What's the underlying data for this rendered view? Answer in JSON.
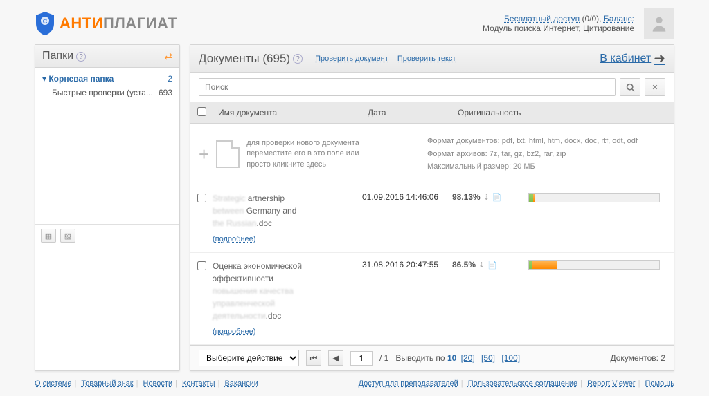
{
  "brand": {
    "part1": "АНТИ",
    "part2": "ПЛАГИАТ"
  },
  "account": {
    "free": "Бесплатный доступ",
    "ratio": "(0/0),",
    "balance": "Баланс:",
    "modules": "Модуль поиска Интернет, Цитирование"
  },
  "sidebar": {
    "title": "Папки",
    "root": {
      "label": "Корневая папка",
      "count": "2"
    },
    "child": {
      "label": "Быстрые проверки (уста...",
      "count": "693"
    }
  },
  "content": {
    "title": "Документы",
    "count": "(695)",
    "check_doc": "Проверить документ",
    "check_text": "Проверить текст",
    "cabinet": "В кабинет",
    "search_placeholder": "Поиск"
  },
  "cols": {
    "name": "Имя документа",
    "date": "Дата",
    "orig": "Оригинальность"
  },
  "upload": {
    "hint": "для проверки нового документа переместите его в это поле или просто кликните здесь",
    "formats": "Формат документов: pdf, txt, html, htm, docx, doc, rtf, odt, odf",
    "archives": "Формат архивов: 7z, tar, gz, bz2, rar, zip",
    "maxsize": "Максимальный размер: 20 МБ"
  },
  "rows": [
    {
      "name_blur1": "Strategic ",
      "name_vis1": "artnership",
      "name_blur2": "between ",
      "name_vis2": "Germany and",
      "name_blur3": "the Russian",
      "ext": ".doc",
      "more": "(подробнее)",
      "date": "01.09.2016 14:46:06",
      "pct": "98.13%",
      "green": 3,
      "orange_left": 3,
      "orange_w": 2
    },
    {
      "name_vis1": "Оценка экономической",
      "name_vis2": "эффективности",
      "name_blur1": "...",
      "name_blur2": "...",
      "ext": ".doc",
      "more": "(подробнее)",
      "date": "31.08.2016 20:47:55",
      "pct": "86.5%",
      "green": 2,
      "orange_left": 2,
      "orange_w": 20
    }
  ],
  "footer": {
    "action": "Выберите действие",
    "page": "1",
    "total": "/ 1",
    "perpage_label": "Выводить по",
    "pp10": "10",
    "pp20": "[20]",
    "pp50": "[50]",
    "pp100": "[100]",
    "doccount": "Документов: 2"
  },
  "bottom": {
    "left": [
      "О системе",
      "Товарный знак",
      "Новости",
      "Контакты",
      "Вакансии"
    ],
    "right": [
      "Доступ для преподавателей",
      "Пользовательское соглашение",
      "Report Viewer",
      "Помощь"
    ]
  }
}
